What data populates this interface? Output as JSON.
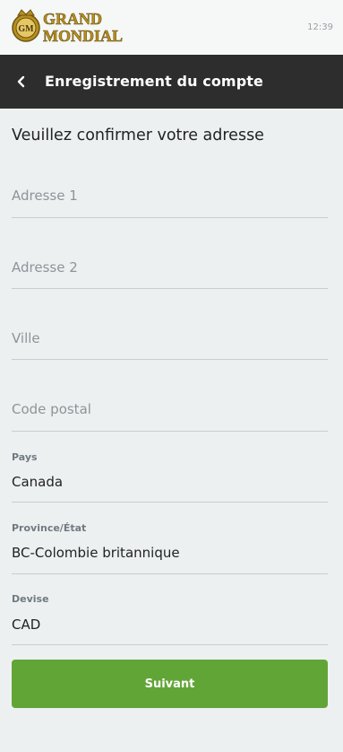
{
  "status_bar": {
    "time": "12:39"
  },
  "brand": {
    "line1": "GRAND",
    "line2": "MONDIAL",
    "emblem_letters": "GM",
    "colors": {
      "gold": "#b8901e",
      "gold_dark": "#6b5410"
    }
  },
  "header": {
    "back_icon": "chevron-left-icon",
    "title": "Enregistrement du compte",
    "background": "#2d2d2d"
  },
  "form": {
    "title": "Veuillez confirmer votre adresse",
    "address1": {
      "placeholder": "Adresse 1"
    },
    "address2": {
      "placeholder": "Adresse 2"
    },
    "city": {
      "placeholder": "Ville"
    },
    "postal_code": {
      "placeholder": "Code postal"
    },
    "country": {
      "label": "Pays",
      "value": "Canada"
    },
    "province": {
      "label": "Province/État",
      "value": "BC-Colombie britannique"
    },
    "currency": {
      "label": "Devise",
      "value": "CAD"
    },
    "submit_label": "Suivant",
    "submit_color": "#62a537"
  }
}
